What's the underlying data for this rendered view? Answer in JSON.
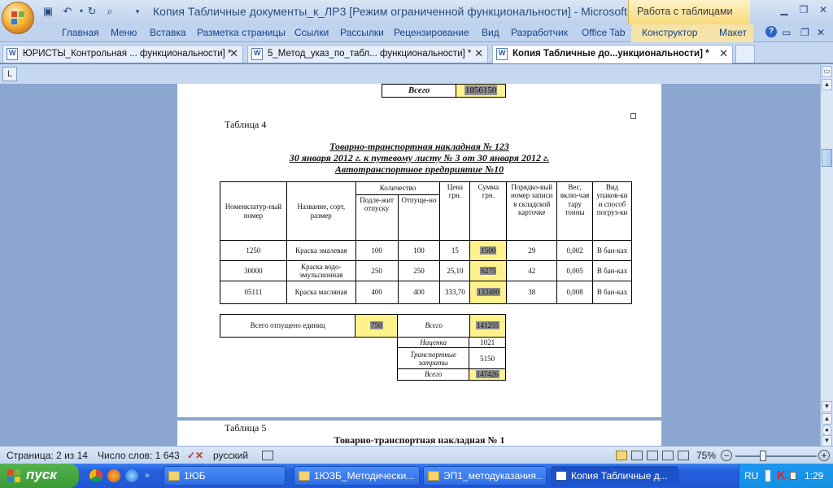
{
  "window": {
    "title": "Копия Табличные документы_к_ЛР3 [Режим ограниченной функциональности] - Microsoft Wo...",
    "context_tab": "Работа с таблицами"
  },
  "ribbon": {
    "tabs": [
      "Главная",
      "Меню",
      "Вставка",
      "Разметка страницы",
      "Ссылки",
      "Рассылки",
      "Рецензирование",
      "Вид",
      "Разработчик",
      "Office Tab"
    ],
    "context_tabs": [
      "Конструктор",
      "Макет"
    ]
  },
  "doc_tabs": [
    {
      "label": "ЮРИСТЫ_Контрольная ... функциональности] *",
      "active": false
    },
    {
      "label": "5_Метод_указ_по_табл... функциональности] *",
      "active": false
    },
    {
      "label": "Копия Табличные до...ункциональности] *",
      "active": true
    }
  ],
  "document": {
    "top_table": {
      "label": "Всего",
      "value": "1856150"
    },
    "table4": {
      "caption": "Таблица 4",
      "title_lines": [
        "Товарно-транспортная накладная № 123",
        "30 января 2012 г. к путевому листу № 3 от 30 января 2012 г.",
        "Автотранспортное предприятие №10"
      ],
      "headers": {
        "nomenclature": "Номенклатур-ный номер",
        "name": "Название, сорт, размер",
        "quantity": "Количество",
        "to_issue": "Подле-жит отпуску",
        "issued": "Отпуще-но",
        "price": "Цена грн.",
        "sum": "Сумма грн.",
        "card_number": "Порядко-вый номер записи в складской карточке",
        "weight": "Вес, вклю-чая тару тонны",
        "packing": "Вид упаков-ки и способ погруз-ки"
      },
      "rows": [
        {
          "nom": "1250",
          "name": "Краска эмалевая",
          "to_issue": "100",
          "issued": "100",
          "price": "15",
          "sum": "1500",
          "card": "29",
          "weight": "0,002",
          "pack": "В бан-ках"
        },
        {
          "nom": "30000",
          "name": "Краска водо-эмульсионная",
          "to_issue": "250",
          "issued": "250",
          "price": "25,10",
          "sum": "6275",
          "card": "42",
          "weight": "0,005",
          "pack": "В бан-ках"
        },
        {
          "nom": "05111",
          "name": "Краска масляная",
          "to_issue": "400",
          "issued": "400",
          "price": "333,70",
          "sum": "133480",
          "card": "38",
          "weight": "0,008",
          "pack": "В бан-ках"
        }
      ],
      "total_issued_label": "Всего отпущено единиц",
      "total_issued_value": "750",
      "total_label": "Всего",
      "total_value": "141255",
      "markup_label": "Наценка",
      "markup_value": "1021",
      "transport_label": "Транспортные затраты",
      "transport_value": "5150",
      "grand_label": "Всего",
      "grand_value": "147426"
    },
    "table5": {
      "caption": "Таблица 5",
      "title": "Товарно-транспортная накладная № 1"
    }
  },
  "status": {
    "page": "Страница: 2 из 14",
    "words": "Число слов: 1 643",
    "language": "русский",
    "zoom": "75%"
  },
  "taskbar": {
    "start": "пуск",
    "tasks": [
      {
        "label": "1ЮБ",
        "active": false
      },
      {
        "label": "1ЮЗБ_Методически...",
        "active": false
      },
      {
        "label": "ЭП1_методуказания...",
        "active": false
      },
      {
        "label": "Копия Табличные д...",
        "active": true
      }
    ],
    "lang": "RU",
    "clock": "1:29"
  }
}
